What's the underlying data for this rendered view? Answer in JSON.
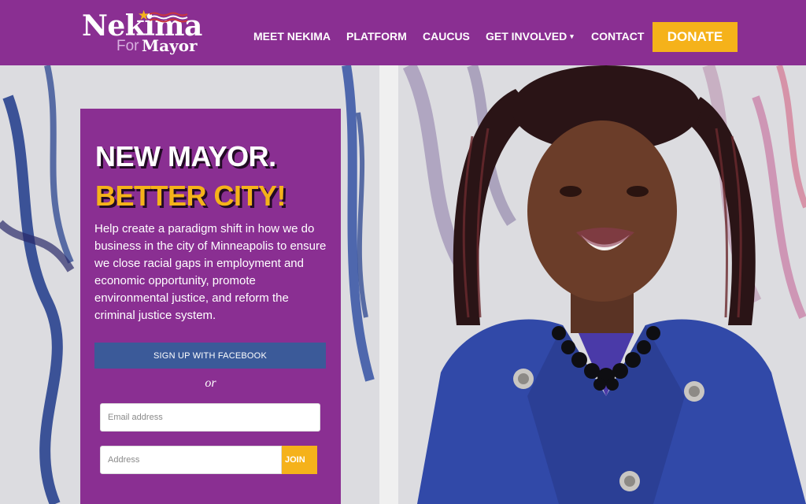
{
  "brand": {
    "name": "Nekima",
    "for": "For",
    "mayor": "Mayor",
    "accent": "#f5b21a",
    "purple": "#8a2f92"
  },
  "nav": {
    "items": [
      {
        "label": "MEET NEKIMA"
      },
      {
        "label": "PLATFORM"
      },
      {
        "label": "CAUCUS"
      },
      {
        "label": "GET INVOLVED",
        "caret": "▾"
      },
      {
        "label": "CONTACT"
      }
    ],
    "donate": "DONATE"
  },
  "hero": {
    "headline_1": "NEW MAYOR.",
    "headline_2": "BETTER CITY!",
    "body": "Help create a paradigm shift in how we do business in the city of Minneapolis to ensure we close racial gaps in employment and economic opportunity, promote environmental justice, and reform the criminal justice system.",
    "facebook_button": "SIGN UP WITH FACEBOOK",
    "or": "or",
    "email_placeholder": "Email address",
    "address_placeholder": "Address",
    "join": "JOIN",
    "facebook_color": "#3b5a99"
  }
}
